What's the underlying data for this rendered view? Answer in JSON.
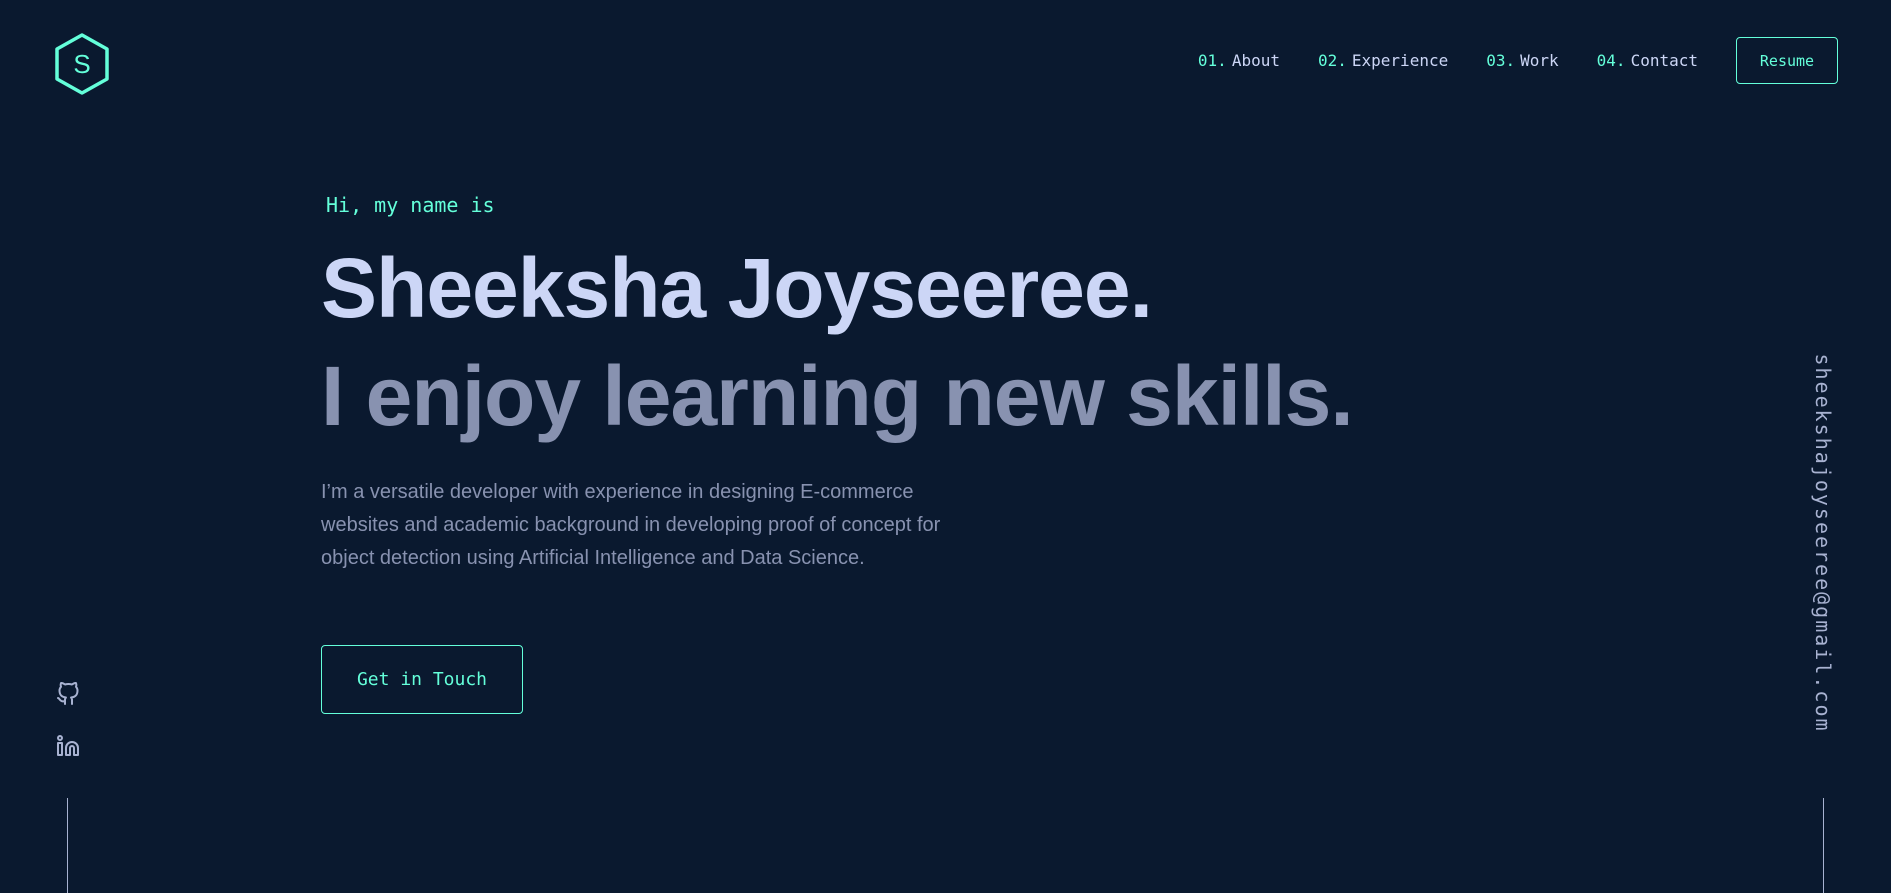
{
  "logo": {
    "letter": "S",
    "icon": "hexagon-logo-icon"
  },
  "nav": {
    "items": [
      {
        "num": "01.",
        "label": "About"
      },
      {
        "num": "02.",
        "label": "Experience"
      },
      {
        "num": "03.",
        "label": "Work"
      },
      {
        "num": "04.",
        "label": "Contact"
      }
    ],
    "resume_label": "Resume"
  },
  "hero": {
    "greeting": "Hi, my name is",
    "name": "Sheeksha Joyseeree.",
    "tagline": "I enjoy learning new skills.",
    "description": "I’m a versatile developer with experience in designing E-commerce websites and academic background in developing proof of concept for object detection using Artificial Intelligence and Data Science.",
    "cta_label": "Get in Touch"
  },
  "social": [
    {
      "icon": "github-icon"
    },
    {
      "icon": "linkedin-icon"
    }
  ],
  "email": "sheekshajoyseeree@gmail.com",
  "colors": {
    "background": "#0a192f",
    "accent": "#64ffda",
    "heading": "#ccd6f6",
    "body_text": "#8892b0",
    "light_slate": "#a8b2d1"
  }
}
